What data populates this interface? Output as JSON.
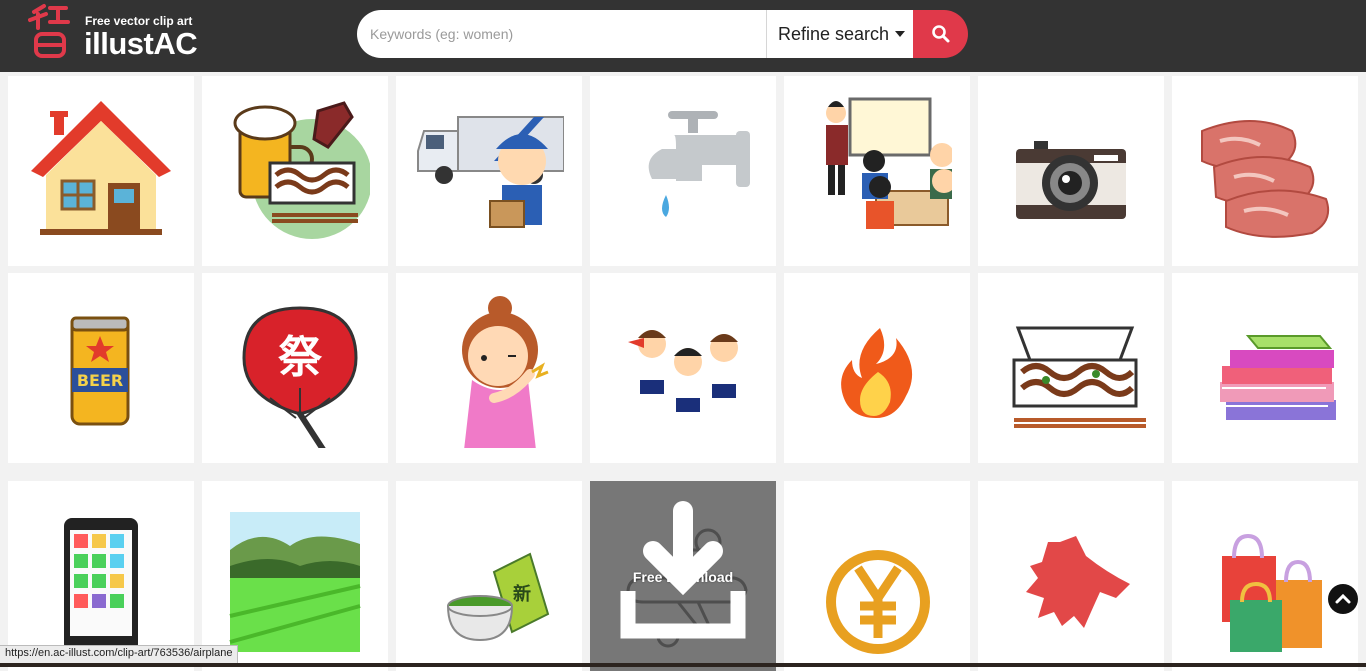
{
  "header": {
    "tagline": "Free vector clip art",
    "brand": "illustAC",
    "colors": {
      "bar": "#333333",
      "accent": "#e0394a"
    }
  },
  "search": {
    "placeholder": "Keywords (eg: women)",
    "value": "",
    "refine_label": "Refine search",
    "button_icon": "search-icon"
  },
  "grid": {
    "tiles": [
      {
        "icon": "house-illustration"
      },
      {
        "icon": "beer-and-yakisoba-illustration"
      },
      {
        "icon": "delivery-driver-truck-illustration"
      },
      {
        "icon": "water-faucet-illustration"
      },
      {
        "icon": "classroom-presentation-illustration"
      },
      {
        "icon": "camera-illustration"
      },
      {
        "icon": "raw-meat-illustration"
      },
      {
        "icon": "beer-can-illustration"
      },
      {
        "icon": "festival-fan-illustration"
      },
      {
        "icon": "woman-shoulder-pain-illustration"
      },
      {
        "icon": "cheering-kids-illustration"
      },
      {
        "icon": "fire-illustration"
      },
      {
        "icon": "yakisoba-box-illustration"
      },
      {
        "icon": "book-stack-illustration"
      },
      {
        "icon": "smartphone-illustration"
      },
      {
        "icon": "rice-field-illustration"
      },
      {
        "icon": "green-tea-illustration"
      },
      {
        "icon": "airplane-illustration",
        "hover": true
      },
      {
        "icon": "yen-coin-illustration"
      },
      {
        "icon": "hokkaido-map-illustration"
      },
      {
        "icon": "shopping-bags-illustration"
      }
    ],
    "hover_label": "Free Download"
  },
  "status_bar": {
    "url": "https://en.ac-illust.com/clip-art/763536/airplane"
  }
}
